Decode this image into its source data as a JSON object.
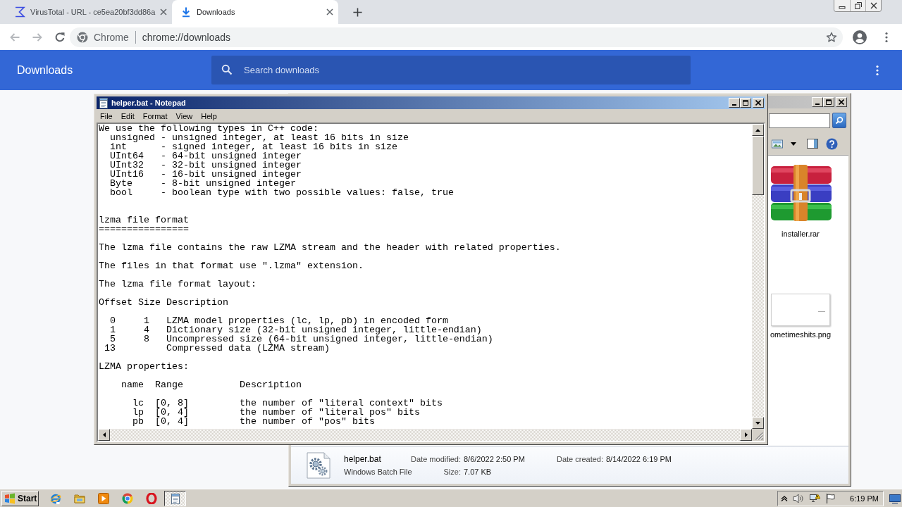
{
  "browser": {
    "tabs": [
      {
        "kind": "web",
        "title": "VirusTotal - URL - ce5ea20bf3dd86a",
        "selected": false
      },
      {
        "kind": "downloads",
        "title": "Downloads",
        "selected": true
      }
    ],
    "omnibox": {
      "chip": "Chrome",
      "url": "chrome://downloads"
    }
  },
  "downloads_page": {
    "title": "Downloads",
    "search": {
      "placeholder": "Search downloads"
    }
  },
  "notepad": {
    "title": "helper.bat - Notepad",
    "menu": [
      "File",
      "Edit",
      "Format",
      "View",
      "Help"
    ],
    "text": "We use the following types in C++ code:\n  unsigned - unsigned integer, at least 16 bits in size\n  int      - signed integer, at least 16 bits in size\n  UInt64   - 64-bit unsigned integer\n  UInt32   - 32-bit unsigned integer\n  UInt16   - 16-bit unsigned integer\n  Byte     - 8-bit unsigned integer\n  bool     - boolean type with two possible values: false, true\n\n\nlzma file format\n================\n\nThe lzma file contains the raw LZMA stream and the header with related properties.\n\nThe files in that format use \".lzma\" extension.\n\nThe lzma file format layout:\n\nOffset Size Description\n\n  0     1   LZMA model properties (lc, lp, pb) in encoded form\n  1     4   Dictionary size (32-bit unsigned integer, little-endian)\n  5     8   Uncompressed size (64-bit unsigned integer, little-endian)\n 13         Compressed data (LZMA stream)\n\nLZMA properties:\n\n    name  Range          Description\n\n      lc  [0, 8]         the number of \"literal context\" bits\n      lp  [0, 4]         the number of \"literal pos\" bits\n      pb  [0, 4]         the number of \"pos\" bits"
  },
  "explorer": {
    "items": [
      {
        "kind": "archive",
        "name": "installer.rar"
      },
      {
        "kind": "image",
        "name": "ometimeshits.png"
      }
    ],
    "details": {
      "name": "helper.bat",
      "type": "Windows Batch File",
      "properties": [
        [
          {
            "label": "Date modified:",
            "value": "8/6/2022 2:50 PM"
          },
          {
            "label": "Date created:",
            "value": "8/14/2022 6:19 PM"
          }
        ],
        [
          {
            "label": "Size:",
            "value": "7.07 KB"
          }
        ]
      ]
    }
  },
  "taskbar": {
    "start": "Start",
    "apps": [
      {
        "kind": "ie",
        "selected": false
      },
      {
        "kind": "folder",
        "selected": false
      },
      {
        "kind": "media",
        "selected": false
      },
      {
        "kind": "chrome",
        "selected": false
      },
      {
        "kind": "opera",
        "selected": false
      },
      {
        "kind": "notepad",
        "selected": true
      }
    ],
    "clock": "6:19 PM"
  }
}
